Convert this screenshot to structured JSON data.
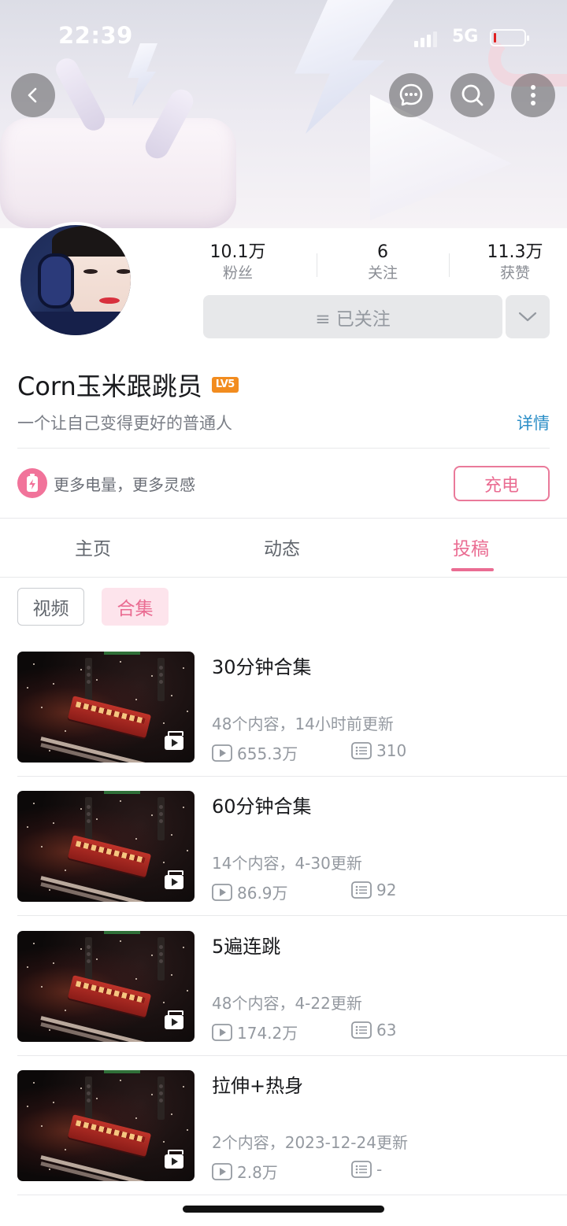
{
  "status_bar": {
    "time": "22:39",
    "network": "5G",
    "battery_color": "#e02020"
  },
  "header": {
    "back_icon": "chevron-left-icon",
    "message_icon": "message-bubble-icon",
    "search_icon": "search-icon",
    "more_icon": "more-vertical-icon"
  },
  "profile": {
    "stats": [
      {
        "value": "10.1万",
        "label": "粉丝"
      },
      {
        "value": "6",
        "label": "关注"
      },
      {
        "value": "11.3万",
        "label": "获赞"
      }
    ],
    "follow_label": "≡ 已关注",
    "name": "Corn玉米跟跳员",
    "level": "LV5",
    "signature": "一个让自己变得更好的普通人",
    "detail_link": "详情"
  },
  "charge": {
    "text": "更多电量，更多灵感",
    "button": "充电",
    "accent": "#ea6c92"
  },
  "tabs": [
    {
      "label": "主页",
      "active": false
    },
    {
      "label": "动态",
      "active": false
    },
    {
      "label": "投稿",
      "active": true
    }
  ],
  "filters": [
    {
      "label": "视频",
      "active": false
    },
    {
      "label": "合集",
      "active": true
    }
  ],
  "collections": [
    {
      "title": "30分钟合集",
      "meta": "48个内容，14小时前更新",
      "views": "655.3万",
      "count": "310"
    },
    {
      "title": "60分钟合集",
      "meta": "14个内容，4-30更新",
      "views": "86.9万",
      "count": "92"
    },
    {
      "title": "5遍连跳",
      "meta": "48个内容，4-22更新",
      "views": "174.2万",
      "count": "63"
    },
    {
      "title": "拉伸+热身",
      "meta": "2个内容，2023-12-24更新",
      "views": "2.8万",
      "count": "-"
    }
  ]
}
